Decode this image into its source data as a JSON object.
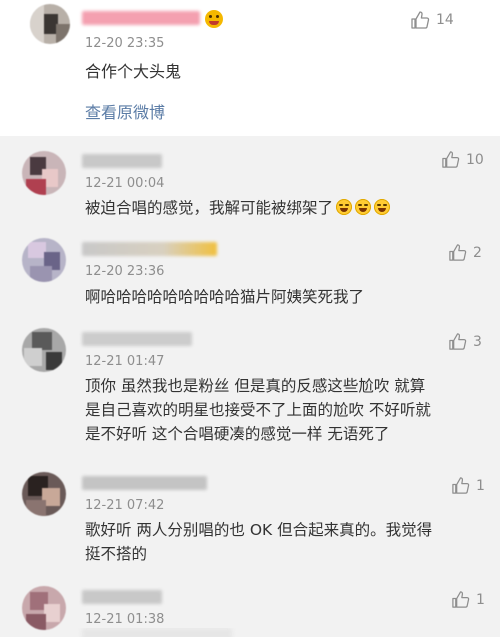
{
  "main_comment": {
    "time": "12-20 23:35",
    "text": "合作个大头鬼",
    "likes": "14",
    "view_original_label": "查看原微博"
  },
  "replies": [
    {
      "time": "12-21 00:04",
      "text": "被迫合唱的感觉，我解可能被绑架了",
      "likes": "10",
      "emoji": "laughing-tears"
    },
    {
      "time": "12-20 23:36",
      "text": "啊哈哈哈哈哈哈哈哈哈猫片阿姨笑死我了",
      "likes": "2"
    },
    {
      "time": "12-21 01:47",
      "lines": [
        "顶你 虽然我也是粉丝 但是真的反感这些尬吹 就算",
        "是自己喜欢的明星也接受不了上面的尬吹 不好听就",
        "是不好听 这个合唱硬凑的感觉一样 无语死了"
      ],
      "likes": "3"
    },
    {
      "time": "12-21 07:42",
      "lines": [
        "歌好听 两人分别唱的也 OK 但合起来真的。我觉得",
        "挺不搭的"
      ],
      "likes": "1"
    },
    {
      "time": "12-21 01:38",
      "likes": "1"
    }
  ],
  "colors": {
    "link": "#5b7ca6",
    "reply_background": "#f2f2f2",
    "meta_text": "#8e8e8e"
  }
}
